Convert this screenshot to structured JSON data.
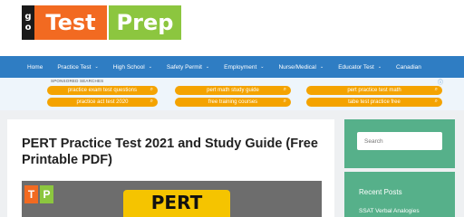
{
  "logo": {
    "go_top": "g",
    "go_bottom": "o",
    "test": "Test",
    "prep": "Prep"
  },
  "nav": [
    {
      "label": "Home",
      "caret": false
    },
    {
      "label": "Practice Test",
      "caret": true
    },
    {
      "label": "High School",
      "caret": true
    },
    {
      "label": "Safety Permit",
      "caret": true
    },
    {
      "label": "Employment",
      "caret": true
    },
    {
      "label": "Nurse/Medical",
      "caret": true
    },
    {
      "label": "Educator Test",
      "caret": true
    },
    {
      "label": "Canadian",
      "caret": false
    }
  ],
  "sponsored": {
    "label": "SPONSORED SEARCHES",
    "info_icon": "info-icon",
    "pills": [
      "practice exam test questions",
      "pert math study guide",
      "pert practice test math",
      "practice act test 2020",
      "free training courses",
      "tabe test practice free"
    ]
  },
  "article": {
    "title": "PERT Practice Test 2021 and Study Guide (Free Printable PDF)",
    "thumb_t": "T",
    "thumb_p": "P",
    "thumb_badge": "PERT"
  },
  "sidebar": {
    "search_placeholder": "Search",
    "recent_title": "Recent Posts",
    "recent_first": "SSAT Verbal Analogies"
  },
  "colors": {
    "nav_bg": "#2f7dc3",
    "pill_bg": "#f4a300",
    "sidebar_bg": "#56b08a",
    "logo_orange": "#f26a21",
    "logo_green": "#8cc63f"
  }
}
